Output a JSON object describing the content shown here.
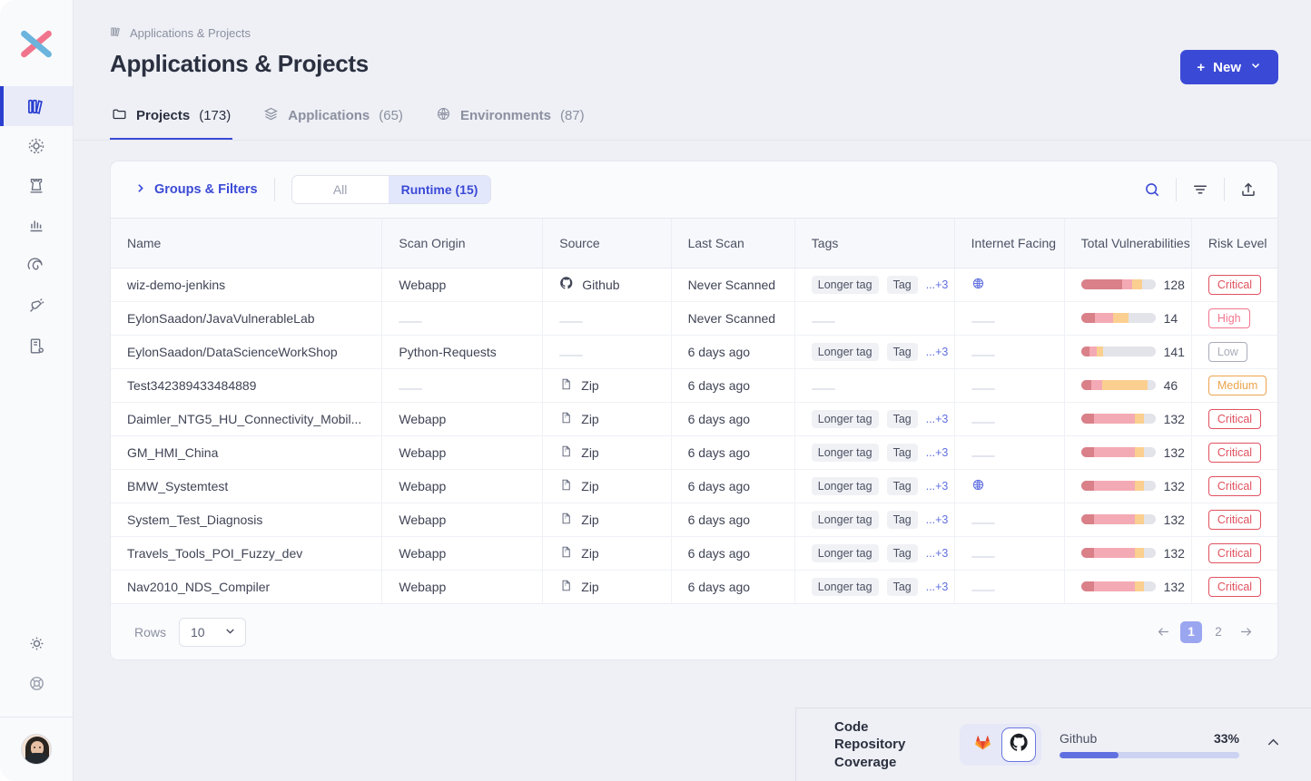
{
  "brand": {
    "logo_name": "wiz-logo",
    "accent": "#3b4ad6"
  },
  "sidebar": {
    "items": [
      {
        "name": "sidebar-item-inventory",
        "icon": "books-icon",
        "active": true
      },
      {
        "name": "sidebar-item-explorer",
        "icon": "atom-icon",
        "active": false
      },
      {
        "name": "sidebar-item-fortress",
        "icon": "rook-icon",
        "active": false
      },
      {
        "name": "sidebar-item-reports",
        "icon": "bar-chart-icon",
        "active": false
      },
      {
        "name": "sidebar-item-radar",
        "icon": "spiral-icon",
        "active": false
      },
      {
        "name": "sidebar-item-integrations",
        "icon": "plug-icon",
        "active": false
      },
      {
        "name": "sidebar-item-policies",
        "icon": "clipboard-gear-icon",
        "active": false
      }
    ],
    "bottom": [
      {
        "name": "sidebar-item-settings",
        "icon": "gear-icon"
      },
      {
        "name": "sidebar-item-help",
        "icon": "lifebuoy-icon"
      }
    ],
    "avatar_name": "user-avatar"
  },
  "header": {
    "breadcrumb": "Applications & Projects",
    "breadcrumb_icon": "books-icon",
    "title": "Applications & Projects",
    "new_button": {
      "label": "New",
      "plus": "+",
      "caret": "chevron-down-icon"
    }
  },
  "tabs": [
    {
      "icon": "folder-icon",
      "label": "Projects",
      "count": "(173)",
      "active": true
    },
    {
      "icon": "layers-icon",
      "label": "Applications",
      "count": "(65)",
      "active": false
    },
    {
      "icon": "globe-mesh-icon",
      "label": "Environments",
      "count": "(87)",
      "active": false
    }
  ],
  "toolbar": {
    "groups_filters": "Groups & Filters",
    "chevron_icon": "chevron-right-icon",
    "segments": [
      {
        "label": "All",
        "active": false
      },
      {
        "label": "Runtime (15)",
        "active": true
      }
    ],
    "icons": [
      {
        "name": "search-icon",
        "color": "#3b4ad6"
      },
      {
        "name": "filter-icon",
        "color": "#3f4455"
      },
      {
        "name": "export-icon",
        "color": "#3f4455"
      }
    ]
  },
  "table": {
    "columns": [
      "Name",
      "Scan Origin",
      "Source",
      "Last Scan",
      "Tags",
      "Internet Facing",
      "Total Vulnerabilities",
      "Risk Level"
    ],
    "tag_labels": {
      "long": "Longer tag",
      "short": "Tag",
      "more": "...+3"
    },
    "rows": [
      {
        "name": "wiz-demo-jenkins",
        "scan_origin": "Webapp",
        "source": "Github",
        "source_icon": "github-icon",
        "last_scan": "Never Scanned",
        "tags": true,
        "internet_facing": true,
        "vuln_count": "128",
        "bar": [
          55,
          14,
          13
        ],
        "risk": "Critical"
      },
      {
        "name": "EylonSaadon/JavaVulnerableLab",
        "scan_origin": "",
        "source": "",
        "source_icon": "",
        "last_scan": "Never Scanned",
        "tags": false,
        "internet_facing": false,
        "vuln_count": "14",
        "bar": [
          19,
          24,
          21
        ],
        "risk": "High"
      },
      {
        "name": "EylonSaadon/DataScienceWorkShop",
        "scan_origin": "Python-Requests",
        "source": "",
        "source_icon": "",
        "last_scan": "6 days ago",
        "tags": true,
        "internet_facing": false,
        "vuln_count": "141",
        "bar": [
          12,
          9,
          9
        ],
        "risk": "Low"
      },
      {
        "name": "Test342389433484889",
        "scan_origin": "",
        "source": "Zip",
        "source_icon": "zip-icon",
        "last_scan": "6 days ago",
        "tags": false,
        "internet_facing": false,
        "vuln_count": "46",
        "bar": [
          14,
          14,
          62
        ],
        "risk": "Medium"
      },
      {
        "name": "Daimler_NTG5_HU_Connectivity_Mobil...",
        "scan_origin": "Webapp",
        "source": "Zip",
        "source_icon": "zip-icon",
        "last_scan": "6 days ago",
        "tags": true,
        "internet_facing": false,
        "vuln_count": "132",
        "bar": [
          17,
          55,
          13
        ],
        "risk": "Critical"
      },
      {
        "name": "GM_HMI_China",
        "scan_origin": "Webapp",
        "source": "Zip",
        "source_icon": "zip-icon",
        "last_scan": "6 days ago",
        "tags": true,
        "internet_facing": false,
        "vuln_count": "132",
        "bar": [
          17,
          55,
          13
        ],
        "risk": "Critical"
      },
      {
        "name": "BMW_Systemtest",
        "scan_origin": "Webapp",
        "source": "Zip",
        "source_icon": "zip-icon",
        "last_scan": "6 days ago",
        "tags": true,
        "internet_facing": true,
        "vuln_count": "132",
        "bar": [
          17,
          55,
          13
        ],
        "risk": "Critical"
      },
      {
        "name": "System_Test_Diagnosis",
        "scan_origin": "Webapp",
        "source": "Zip",
        "source_icon": "zip-icon",
        "last_scan": "6 days ago",
        "tags": true,
        "internet_facing": false,
        "vuln_count": "132",
        "bar": [
          17,
          55,
          13
        ],
        "risk": "Critical"
      },
      {
        "name": "Travels_Tools_POI_Fuzzy_dev",
        "scan_origin": "Webapp",
        "source": "Zip",
        "source_icon": "zip-icon",
        "last_scan": "6 days ago",
        "tags": true,
        "internet_facing": false,
        "vuln_count": "132",
        "bar": [
          17,
          55,
          13
        ],
        "risk": "Critical"
      },
      {
        "name": "Nav2010_NDS_Compiler",
        "scan_origin": "Webapp",
        "source": "Zip",
        "source_icon": "zip-icon",
        "last_scan": "6 days ago",
        "tags": true,
        "internet_facing": false,
        "vuln_count": "132",
        "bar": [
          17,
          55,
          13
        ],
        "risk": "Critical"
      }
    ],
    "risk_colors": {
      "Critical": "#e0525f",
      "High": "#f2758f",
      "Low": "#a9adba",
      "Medium": "#eda44e"
    },
    "bar_colors": {
      "critical": "#d98089",
      "high": "#f4aab4",
      "medium": "#fbcf90",
      "rest": "#e3e4e9"
    }
  },
  "table_footer": {
    "rows_label": "Rows",
    "rows_value": "10",
    "prev_icon": "arrow-left-icon",
    "next_icon": "arrow-right-icon",
    "pages": [
      {
        "label": "1",
        "active": true
      },
      {
        "label": "2",
        "active": false
      }
    ]
  },
  "bottom_bar": {
    "title": "Code Repository Coverage",
    "repos": [
      {
        "name": "gitlab-icon",
        "active": false
      },
      {
        "name": "github-icon",
        "active": true
      }
    ],
    "provider": "Github",
    "percent": "33%",
    "percent_value": 33,
    "collapse_icon": "chevron-up-icon"
  }
}
